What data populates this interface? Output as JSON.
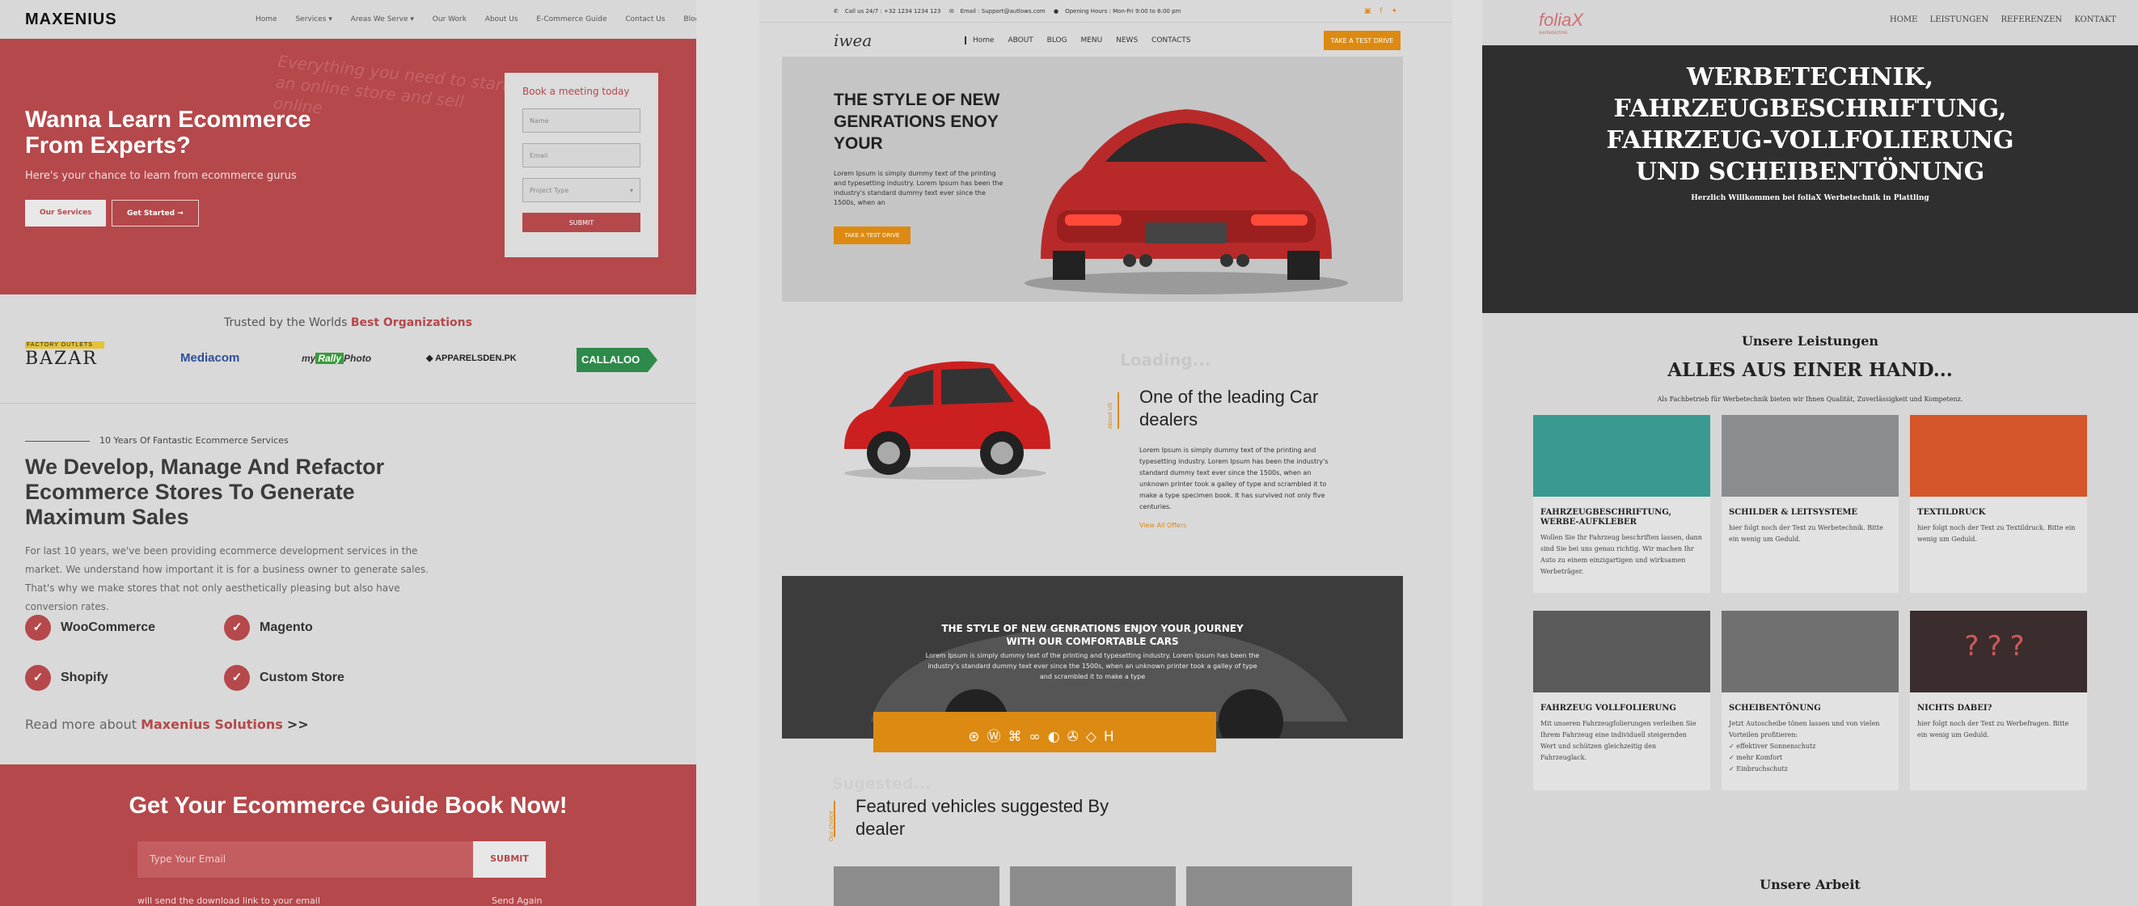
{
  "panel1": {
    "logo": "MAXENIUS",
    "nav": [
      "Home",
      "Services ▾",
      "Areas We Serve ▾",
      "Our Work",
      "About Us",
      "E-Commerce Guide",
      "Contact Us",
      "Blog"
    ],
    "hero": {
      "watermark": "Everything you need to start an online store and sell online",
      "title": "Wanna Learn Ecommerce From Experts?",
      "subtitle": "Here's your chance to learn from ecommerce gurus",
      "btn_services": "Our Services",
      "btn_started": "Get Started →"
    },
    "form": {
      "title": "Book a meeting today",
      "name_placeholder": "Name",
      "email_placeholder": "Email",
      "project_placeholder": "Project Type",
      "submit": "SUBMIT"
    },
    "trusted_prefix": "Trusted by the Worlds",
    "trusted_bold": "Best Organizations",
    "logos": [
      "FACTORY OUTLETS BAZAR",
      "Mediacom",
      "myRallyPhoto",
      "APPARELSDEN.PK",
      "CALLALOO"
    ],
    "years": "10 Years Of Fantastic Ecommerce Services",
    "headline": "We Develop, Manage And Refactor Ecommerce Stores To Generate Maximum Sales",
    "paragraph": "For last 10 years, we've been providing ecommerce development services in the market. We understand how important it is for a business owner to generate sales. That's why we make stores that not only aesthetically pleasing but also have conversion rates.",
    "platforms": [
      "WooCommerce",
      "Magento",
      "Shopify",
      "Custom Store"
    ],
    "readmore_prefix": "Read more about",
    "readmore_link": "Maxenius Solutions",
    "readmore_suffix": ">>",
    "guide": {
      "title": "Get Your Ecommerce Guide Book Now!",
      "email_placeholder": "Type Your Email",
      "submit": "SUBMIT",
      "foot_left": "will send the download link to your email",
      "foot_right": "Send Again"
    }
  },
  "panel2": {
    "topbar": {
      "call": "Call us 24/7 : +32 1234 1234 123",
      "email": "Email : Support@autlows.com",
      "hours": "Opening Hours : Mon-Fri 9:00 to 6:00 pm"
    },
    "logo": "iwea",
    "nav": [
      "Home",
      "ABOUT",
      "BLOG",
      "MENU",
      "NEWS",
      "CONTACTS"
    ],
    "cta": "TAKE A TEST DRIVE",
    "hero": {
      "title": "THE STYLE OF NEW GENRATIONS ENOY YOUR",
      "text": "Lorem Ipsum is simply dummy text of the printing and typesetting industry. Lorem Ipsum has been the industry's standard dummy text ever since the 1500s, when an",
      "button": "TAKE A TEST DRIVE"
    },
    "loading": "Loading...",
    "about_label": "About US",
    "about_title": "One of the leading Car dealers",
    "about_text": "Lorem Ipsum is simply dummy text of the printing and typesetting industry. Lorem Ipsum has been the industry's standard dummy text ever since the 1500s, when an unknown printer took a galley of type and scrambled it to make a type specimen book. It has survived not only five centuries.",
    "view_all": "View All Offers",
    "band": {
      "title": "THE STYLE OF NEW GENRATIONS ENJOY YOUR JOURNEY WITH OUR COMFORTABLE CARS",
      "text": "Lorem Ipsum is simply dummy text of the printing and typesetting industry. Lorem Ipsum has been the industry's standard dummy text ever since the 1500s, when an unknown printer took a galley of type and scrambled it to make a type"
    },
    "suggested_ghost": "Sugested...",
    "our_choice": "Our choice",
    "featured": "Featured vehicles suggested By dealer"
  },
  "panel3": {
    "logo": "foliaX",
    "logo_sub": "werbetechnik",
    "nav": [
      "HOME",
      "LEISTUNGEN",
      "REFERENZEN",
      "KONTAKT"
    ],
    "hero_title": "WERBETECHNIK, FAHRZEUGBESCHRIFTUNG, FAHRZEUG-VOLLFOLIERUNG UND SCHEIBENTÖNUNG",
    "hero_welcome": "Herzlich Willkommen bei foliaX Werbetechnik in Plattling",
    "section_label": "Unsere Leistungen",
    "section_title": "ALLES AUS EINER HAND...",
    "section_intro": "Als Fachbetrieb für Werbetechnik bieten wir Ihnen Qualität, Zuverlässigkeit und Kompetenz.",
    "services": [
      {
        "title": "FAHRZEUGBESCHRIFTUNG, WERBE-AUFKLEBER",
        "text": "Wollen Sie Ihr Fahrzeug beschriften lassen, dann sind Sie bei uns genau richtig. Wir machen Ihr Auto zu einem einzigartigen und wirksamen Werbeträger."
      },
      {
        "title": "SCHILDER & LEITSYSTEME",
        "text": "hier folgt noch der Text zu Werbetechnik. Bitte ein wenig um Geduld."
      },
      {
        "title": "TEXTILDRUCK",
        "text": "hier folgt noch der Text zu Textildruck. Bitte ein wenig um Geduld."
      },
      {
        "title": "FAHRZEUG VOLLFOLIERUNG",
        "text": "Mit unseren Fahrzeugfolierungen verleihen Sie Ihrem Fahrzeug eine individuell steigernden Wert und schützen gleichzeitig den Fahrzeuglack."
      },
      {
        "title": "SCHEIBENTÖNUNG",
        "text": "Jetzt Autoscheibe tönen lassen und von vielen Vorteilen profitieren:"
      },
      {
        "title": "NICHTS DABEI?",
        "text": "hier folgt noch der Text zu Werbefragen. Bitte ein wenig um Geduld."
      }
    ],
    "tint_benefits": [
      "✓ effektiver Sonnenschutz",
      "✓ mehr Komfort",
      "✓ Einbruchschutz"
    ],
    "work_title": "Unsere Arbeit"
  },
  "colors": {
    "maxenius_red": "#b5484b",
    "iwea_orange": "#dc8a12",
    "folia_red": "#d07076"
  }
}
